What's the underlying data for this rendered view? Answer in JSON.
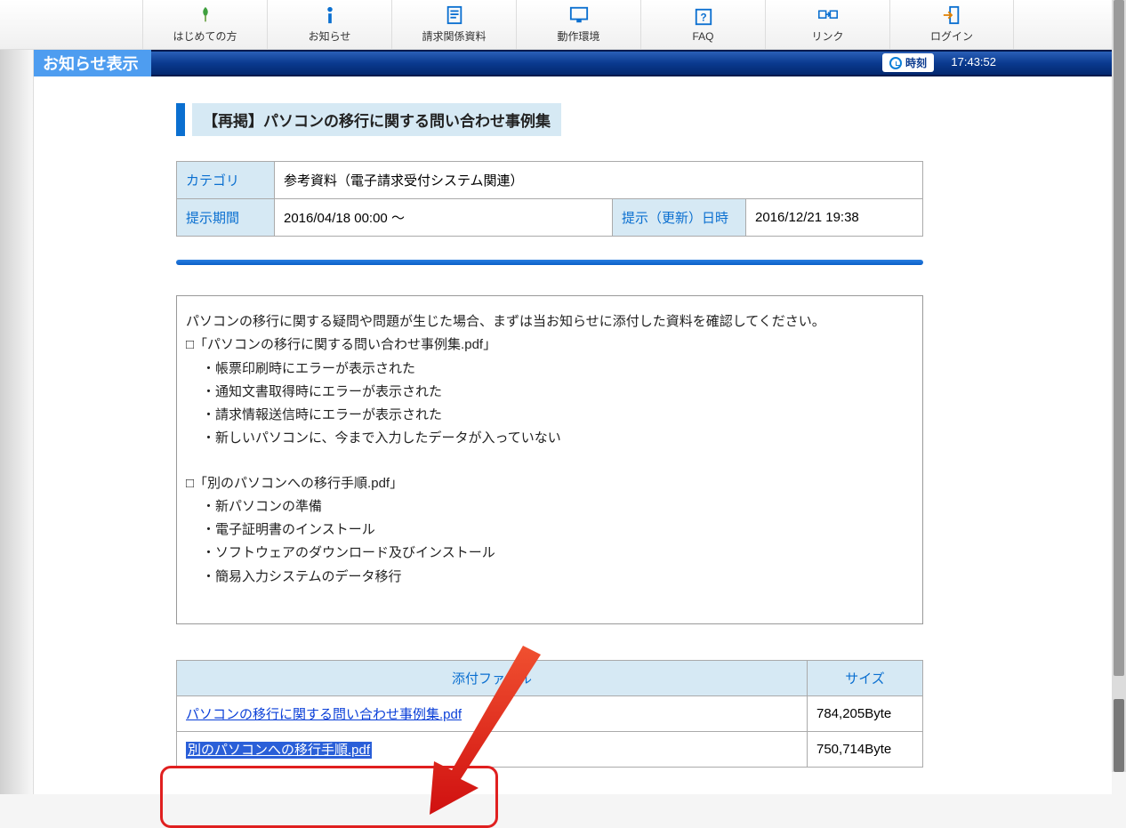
{
  "nav": [
    {
      "label": "はじめての方",
      "icon": "sprout-icon",
      "color": "#3fa03f"
    },
    {
      "label": "お知らせ",
      "icon": "info-icon",
      "color": "#0a6fd0"
    },
    {
      "label": "請求関係資料",
      "icon": "document-icon",
      "color": "#0a6fd0"
    },
    {
      "label": "動作環境",
      "icon": "monitor-icon",
      "color": "#0a6fd0"
    },
    {
      "label": "FAQ",
      "icon": "faq-icon",
      "color": "#0a6fd0"
    },
    {
      "label": "リンク",
      "icon": "link-icon",
      "color": "#0a6fd0"
    },
    {
      "label": "ログイン",
      "icon": "login-icon",
      "color": "#0a6fd0"
    }
  ],
  "banner": {
    "title": "お知らせ表示",
    "clock_label": "時刻",
    "time": "17:43:52"
  },
  "article": {
    "title": "【再掲】パソコンの移行に関する問い合わせ事例集",
    "category_label": "カテゴリ",
    "category_value": "参考資料（電子請求受付システム関連）",
    "period_label": "提示期間",
    "period_value": "2016/04/18 00:00 ～",
    "updated_label": "提示（更新）日時",
    "updated_value": "2016/12/21 19:38"
  },
  "notice": {
    "intro": "パソコンの移行に関する疑問や問題が生じた場合、まずは当お知らせに添付した資料を確認してください。",
    "doc1_title": "□「パソコンの移行に関する問い合わせ事例集.pdf」",
    "doc1_items": [
      "・帳票印刷時にエラーが表示された",
      "・通知文書取得時にエラーが表示された",
      "・請求情報送信時にエラーが表示された",
      "・新しいパソコンに、今まで入力したデータが入っていない"
    ],
    "doc2_title": "□「別のパソコンへの移行手順.pdf」",
    "doc2_items": [
      "・新パソコンの準備",
      "・電子証明書のインストール",
      "・ソフトウェアのダウンロード及びインストール",
      "・簡易入力システムのデータ移行"
    ]
  },
  "attachments": {
    "col_file": "添付ファイル",
    "col_size": "サイズ",
    "rows": [
      {
        "name": "パソコンの移行に関する問い合わせ事例集.pdf",
        "size": "784,205Byte",
        "selected": false
      },
      {
        "name": "別のパソコンへの移行手順.pdf",
        "size": "750,714Byte",
        "selected": true
      }
    ]
  }
}
